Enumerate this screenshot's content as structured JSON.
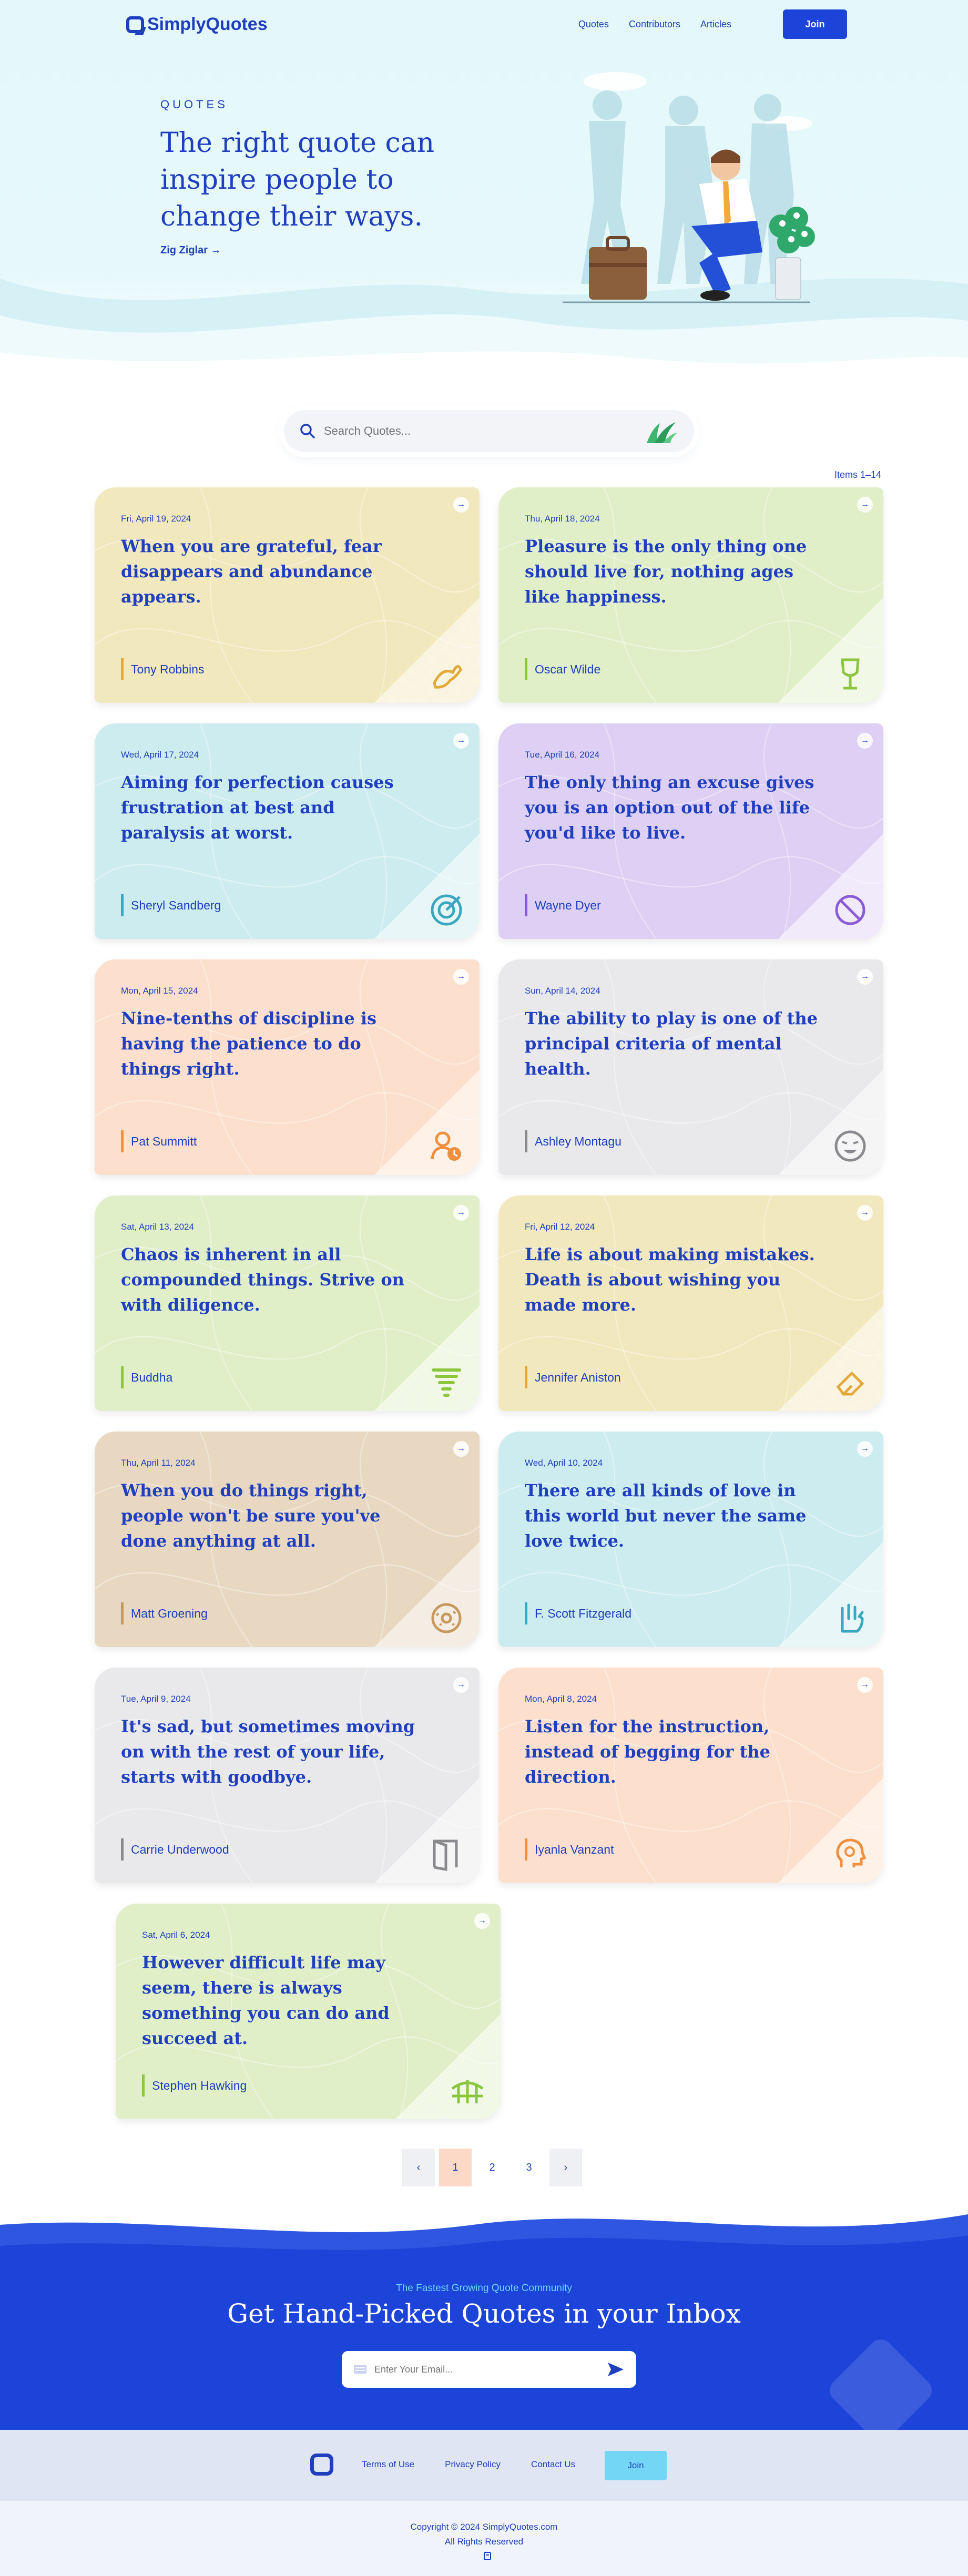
{
  "brand": {
    "name": "SimplyQuotes",
    "primary": "#1d44d8",
    "text": "#1f3fbf"
  },
  "nav": {
    "links": [
      "Quotes",
      "Contributors",
      "Articles"
    ],
    "join_label": "Join"
  },
  "hero": {
    "eyebrow": "QUOTES",
    "quote": "The right quote can inspire people to change their ways.",
    "author": "Zig Ziglar →"
  },
  "search": {
    "placeholder": "Search Quotes..."
  },
  "items_label": "Items 1–14",
  "quotes": [
    {
      "date": "Fri, April 19, 2024",
      "text": "When you are grateful, fear disappears and abundance appears.",
      "author": "Tony Robbins",
      "bg": "#f2e8bd",
      "accent": "#e5a83a",
      "icon": "dove-icon"
    },
    {
      "date": "Thu, April 18, 2024",
      "text": "Pleasure is the only thing one should live for, nothing ages like happiness.",
      "author": "Oscar Wilde",
      "bg": "#e1efc9",
      "accent": "#8cc63f",
      "icon": "wine-glass-icon"
    },
    {
      "date": "Wed, April 17, 2024",
      "text": "Aiming for perfection causes frustration at best and paralysis at worst.",
      "author": "Sheryl Sandberg",
      "bg": "#cdecef",
      "accent": "#3aa7c0",
      "icon": "target-icon"
    },
    {
      "date": "Tue, April 16, 2024",
      "text": "The only thing an excuse gives you is an option out of the life you'd like to live.",
      "author": "Wayne Dyer",
      "bg": "#ddd0f4",
      "accent": "#8a5bd8",
      "icon": "prohibited-icon"
    },
    {
      "date": "Mon, April 15, 2024",
      "text": "Nine-tenths of discipline is having the patience to do things right.",
      "author": "Pat Summitt",
      "bg": "#fce0cd",
      "accent": "#f08f3e",
      "icon": "user-clock-icon"
    },
    {
      "date": "Sun, April 14, 2024",
      "text": "The ability to play is one of the principal criteria of mental health.",
      "author": "Ashley Montagu",
      "bg": "#e9e9eb",
      "accent": "#8a8a8e",
      "icon": "laughing-face-icon"
    },
    {
      "date": "Sat, April 13, 2024",
      "text": "Chaos is inherent in all compounded things. Strive on with diligence.",
      "author": "Buddha",
      "bg": "#e1efc9",
      "accent": "#8cc63f",
      "icon": "tornado-icon"
    },
    {
      "date": "Fri, April 12, 2024",
      "text": "Life is about making mistakes. Death is about wishing you made more.",
      "author": "Jennifer Aniston",
      "bg": "#f2e8bd",
      "accent": "#e5a83a",
      "icon": "eraser-icon"
    },
    {
      "date": "Thu, April 11, 2024",
      "text": "When you do things right, people won't be sure you've done anything at all.",
      "author": "Matt Groening",
      "bg": "#e8d8c2",
      "accent": "#c8995e",
      "icon": "donut-icon"
    },
    {
      "date": "Wed, April 10, 2024",
      "text": "There are all kinds of love in this world but never the same love twice.",
      "author": "F. Scott Fitzgerald",
      "bg": "#cdecef",
      "accent": "#3aa7c0",
      "icon": "love-hand-icon"
    },
    {
      "date": "Tue, April 9, 2024",
      "text": "It's sad, but sometimes moving on with the rest of your life, starts with goodbye.",
      "author": "Carrie Underwood",
      "bg": "#e9e9eb",
      "accent": "#8a8a8e",
      "icon": "door-exit-icon"
    },
    {
      "date": "Mon, April 8, 2024",
      "text": "Listen for the instruction, instead of begging for the direction.",
      "author": "Iyanla Vanzant",
      "bg": "#fce0cd",
      "accent": "#f08f3e",
      "icon": "head-gear-icon"
    },
    {
      "date": "Sat, April 6, 2024",
      "text": "However difficult life may seem, there is always something you can do and succeed at.",
      "author": "Stephen Hawking",
      "bg": "#e1efc9",
      "accent": "#8cc63f",
      "icon": "bridge-icon"
    }
  ],
  "pagination": {
    "prev": "‹",
    "pages": [
      "1",
      "2",
      "3"
    ],
    "next": "›",
    "current": "1"
  },
  "newsletter": {
    "eyebrow": "The Fastest Growing Quote Community",
    "title": "Get Hand-Picked Quotes in your Inbox",
    "placeholder": "Enter Your Email..."
  },
  "footer": {
    "links": [
      "Terms of Use",
      "Privacy Policy",
      "Contact Us"
    ],
    "join_label": "Join",
    "copyright": "Copyright © 2024 SimplyQuotes.com",
    "rights": "All Rights Reserved"
  }
}
